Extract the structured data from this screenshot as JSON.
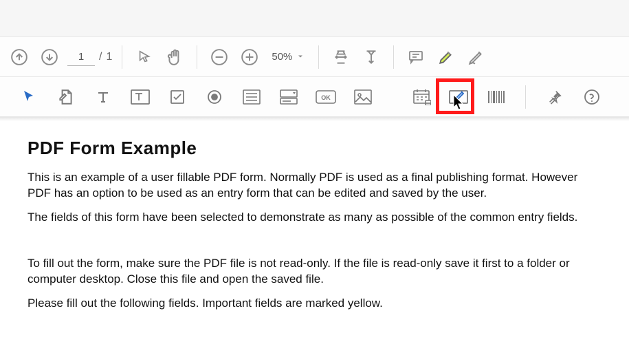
{
  "toolbar1": {
    "page_input": "1",
    "page_sep": "/",
    "page_total": "1",
    "zoom_label": "50%"
  },
  "document": {
    "title": "PDF Form Example",
    "p1": "This is an example of a user fillable PDF form. Normally PDF is used as a final publishing format. However PDF has an option to be used as an entry form that can be edited and saved by the user.",
    "p2": "The fields of this form have been selected to demonstrate as many as possible of the common entry fields.",
    "p3": "To fill out the form, make sure the PDF file is not read-only. If the file is read-only save it first to a folder or computer desktop. Close this file and open the saved file.",
    "p4": "Please fill out the following fields. Important fields are marked yellow."
  },
  "icons": {
    "page_up": "page-up",
    "page_down": "page-down",
    "pointer": "pointer",
    "hand": "hand",
    "zoom_out": "zoom-out",
    "zoom_in": "zoom-in",
    "fit_width": "fit-width",
    "fit_page": "fit-page",
    "comment": "comment",
    "highlighter": "highlighter",
    "sign": "sign",
    "select_cursor": "select-cursor",
    "edit_tool": "edit-tool",
    "text_tool": "text",
    "text_field": "text-field",
    "checkbox": "checkbox",
    "radio": "radio",
    "list_box": "list-box",
    "combo_box": "combo-box",
    "button_field": "button-field",
    "image_field": "image-field",
    "date_field": "date-field",
    "signature_field": "signature-field",
    "barcode": "barcode",
    "pin": "pin",
    "help": "help"
  }
}
